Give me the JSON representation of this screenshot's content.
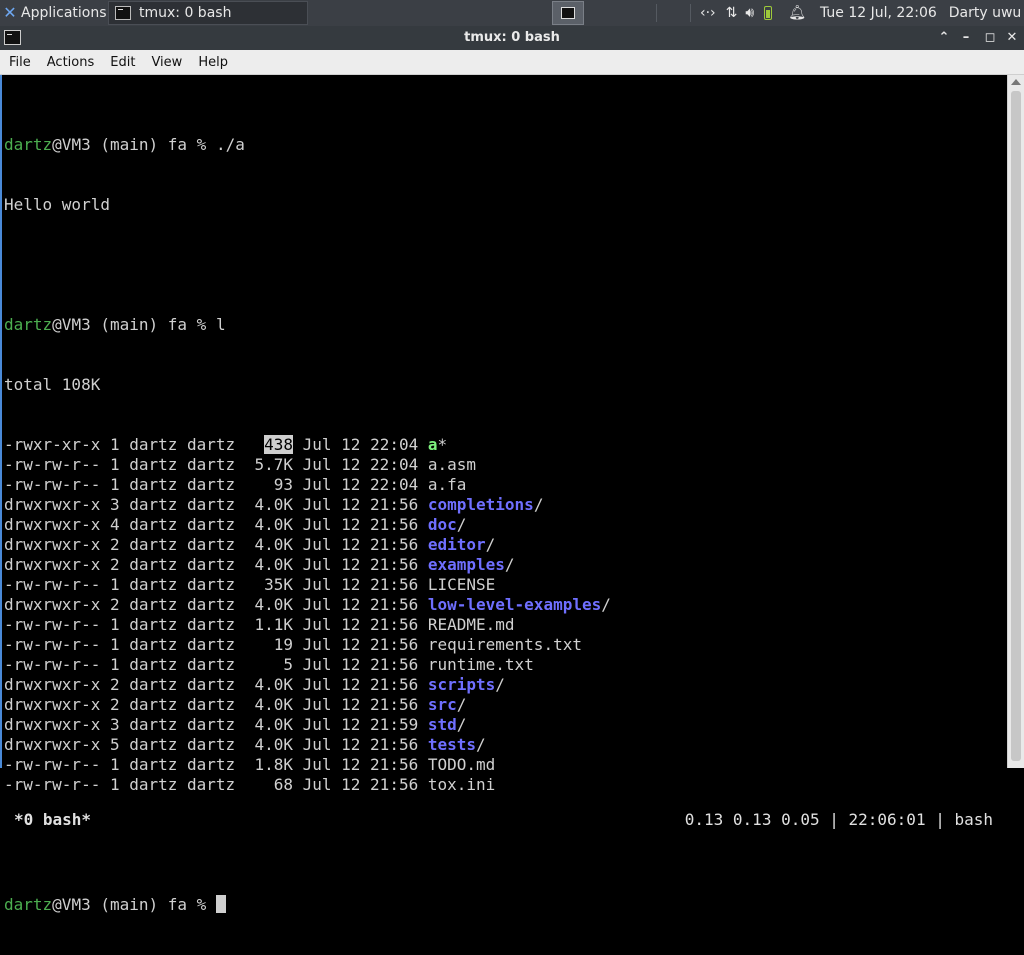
{
  "panel": {
    "applications_label": "Applications",
    "task_label": "tmux: 0 bash",
    "datetime": "Tue 12 Jul, 22:06",
    "user": "Darty uwu"
  },
  "window": {
    "title": "tmux: 0 bash",
    "menu": [
      "File",
      "Actions",
      "Edit",
      "View",
      "Help"
    ]
  },
  "terminal": {
    "prompt_user": "dartz",
    "prompt_rest": "@VM3 (main) fa % ",
    "cmd1": "./a",
    "output1": "Hello world",
    "cmd2": "l",
    "total": "total 108K",
    "listing": [
      {
        "perm": "-rwxr-xr-x",
        "n": "1",
        "owner": "dartz",
        "group": "dartz",
        "size": "438",
        "date": "Jul 12 22:04",
        "name": "a",
        "suffix": "*",
        "kind": "exe"
      },
      {
        "perm": "-rw-rw-r--",
        "n": "1",
        "owner": "dartz",
        "group": "dartz",
        "size": "5.7K",
        "date": "Jul 12 22:04",
        "name": "a.asm",
        "suffix": "",
        "kind": "file"
      },
      {
        "perm": "-rw-rw-r--",
        "n": "1",
        "owner": "dartz",
        "group": "dartz",
        "size": "93",
        "date": "Jul 12 22:04",
        "name": "a.fa",
        "suffix": "",
        "kind": "file"
      },
      {
        "perm": "drwxrwxr-x",
        "n": "3",
        "owner": "dartz",
        "group": "dartz",
        "size": "4.0K",
        "date": "Jul 12 21:56",
        "name": "completions",
        "suffix": "/",
        "kind": "dir"
      },
      {
        "perm": "drwxrwxr-x",
        "n": "4",
        "owner": "dartz",
        "group": "dartz",
        "size": "4.0K",
        "date": "Jul 12 21:56",
        "name": "doc",
        "suffix": "/",
        "kind": "dir"
      },
      {
        "perm": "drwxrwxr-x",
        "n": "2",
        "owner": "dartz",
        "group": "dartz",
        "size": "4.0K",
        "date": "Jul 12 21:56",
        "name": "editor",
        "suffix": "/",
        "kind": "dir"
      },
      {
        "perm": "drwxrwxr-x",
        "n": "2",
        "owner": "dartz",
        "group": "dartz",
        "size": "4.0K",
        "date": "Jul 12 21:56",
        "name": "examples",
        "suffix": "/",
        "kind": "dir"
      },
      {
        "perm": "-rw-rw-r--",
        "n": "1",
        "owner": "dartz",
        "group": "dartz",
        "size": "35K",
        "date": "Jul 12 21:56",
        "name": "LICENSE",
        "suffix": "",
        "kind": "file"
      },
      {
        "perm": "drwxrwxr-x",
        "n": "2",
        "owner": "dartz",
        "group": "dartz",
        "size": "4.0K",
        "date": "Jul 12 21:56",
        "name": "low-level-examples",
        "suffix": "/",
        "kind": "dir"
      },
      {
        "perm": "-rw-rw-r--",
        "n": "1",
        "owner": "dartz",
        "group": "dartz",
        "size": "1.1K",
        "date": "Jul 12 21:56",
        "name": "README.md",
        "suffix": "",
        "kind": "file"
      },
      {
        "perm": "-rw-rw-r--",
        "n": "1",
        "owner": "dartz",
        "group": "dartz",
        "size": "19",
        "date": "Jul 12 21:56",
        "name": "requirements.txt",
        "suffix": "",
        "kind": "file"
      },
      {
        "perm": "-rw-rw-r--",
        "n": "1",
        "owner": "dartz",
        "group": "dartz",
        "size": "5",
        "date": "Jul 12 21:56",
        "name": "runtime.txt",
        "suffix": "",
        "kind": "file"
      },
      {
        "perm": "drwxrwxr-x",
        "n": "2",
        "owner": "dartz",
        "group": "dartz",
        "size": "4.0K",
        "date": "Jul 12 21:56",
        "name": "scripts",
        "suffix": "/",
        "kind": "dir"
      },
      {
        "perm": "drwxrwxr-x",
        "n": "2",
        "owner": "dartz",
        "group": "dartz",
        "size": "4.0K",
        "date": "Jul 12 21:56",
        "name": "src",
        "suffix": "/",
        "kind": "dir"
      },
      {
        "perm": "drwxrwxr-x",
        "n": "3",
        "owner": "dartz",
        "group": "dartz",
        "size": "4.0K",
        "date": "Jul 12 21:59",
        "name": "std",
        "suffix": "/",
        "kind": "dir"
      },
      {
        "perm": "drwxrwxr-x",
        "n": "5",
        "owner": "dartz",
        "group": "dartz",
        "size": "4.0K",
        "date": "Jul 12 21:56",
        "name": "tests",
        "suffix": "/",
        "kind": "dir"
      },
      {
        "perm": "-rw-rw-r--",
        "n": "1",
        "owner": "dartz",
        "group": "dartz",
        "size": "1.8K",
        "date": "Jul 12 21:56",
        "name": "TODO.md",
        "suffix": "",
        "kind": "file"
      },
      {
        "perm": "-rw-rw-r--",
        "n": "1",
        "owner": "dartz",
        "group": "dartz",
        "size": "68",
        "date": "Jul 12 21:56",
        "name": "tox.ini",
        "suffix": "",
        "kind": "file"
      }
    ]
  },
  "tmux": {
    "window_label": "*0 bash*",
    "status_right": "0.13 0.13 0.05 | 22:06:01 | bash"
  },
  "colors": {
    "user": "#4caf50",
    "dir": "#6f6fff",
    "exe": "#7ef07e",
    "accent": "#4a8ad8"
  }
}
